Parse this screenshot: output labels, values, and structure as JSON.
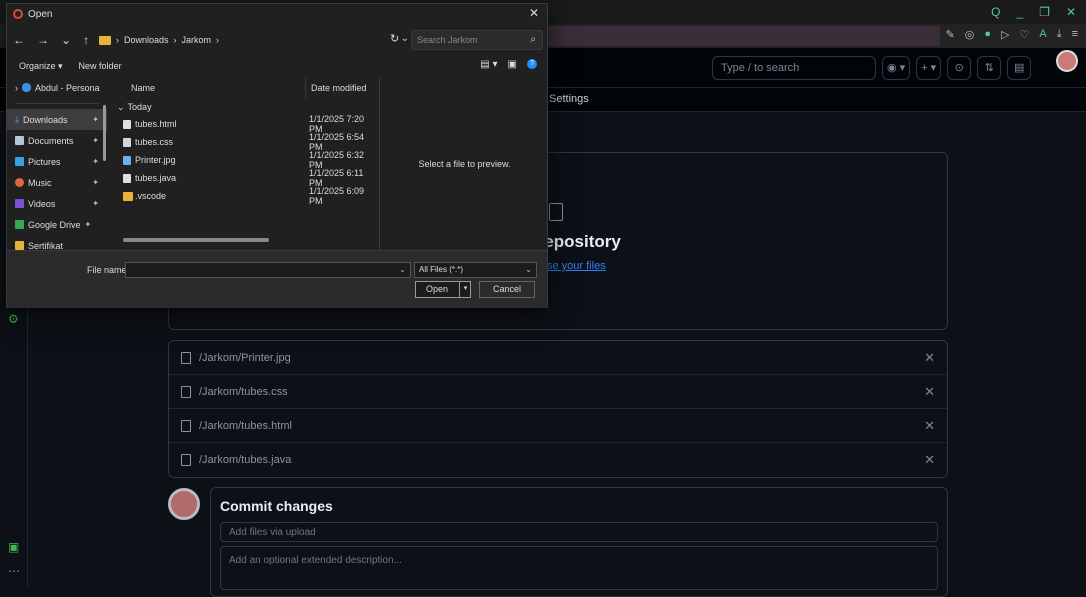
{
  "browser": {
    "top_icons": [
      "Q",
      "_",
      "❐",
      "✕"
    ],
    "toolbar_icons": [
      "✎",
      "◎",
      "●",
      "▷",
      "♡",
      "A",
      "⤓",
      "≡"
    ]
  },
  "github": {
    "search_placeholder": "Type / to search",
    "header_icons": [
      "◉ ▾",
      "+ ▾",
      "⊙",
      "⇅",
      "▤"
    ],
    "tab_settings": "Settings",
    "drop_title": "o add them to your repository",
    "drop_link": "se your files",
    "files": [
      {
        "name": "/Jarkom/Printer.jpg"
      },
      {
        "name": "/Jarkom/tubes.css"
      },
      {
        "name": "/Jarkom/tubes.html"
      },
      {
        "name": "/Jarkom/tubes.java"
      }
    ],
    "remove_icon": "✕",
    "commit": {
      "title": "Commit changes",
      "summary_placeholder": "Add files via upload",
      "description_placeholder": "Add an optional extended description..."
    }
  },
  "dialog": {
    "title": "Open",
    "close": "✕",
    "nav_arrows": [
      "←",
      "→",
      "⌄",
      "↑"
    ],
    "breadcrumb": [
      "Downloads",
      "Jarkom"
    ],
    "breadcrumb_sep": "›",
    "search_placeholder": "Search Jarkom",
    "organize": "Organize ▾",
    "new_folder": "New folder",
    "sidebar": [
      {
        "label": "Abdul - Persona",
        "icon": "cloud-icon",
        "color": "#3a8ee6",
        "pinned": false,
        "expander": "›"
      },
      {
        "label": "Downloads",
        "icon": "download-icon",
        "color": "#4aa3ff",
        "pinned": true,
        "selected": true
      },
      {
        "label": "Documents",
        "icon": "document-icon",
        "color": "#b7c4d4",
        "pinned": true
      },
      {
        "label": "Pictures",
        "icon": "picture-icon",
        "color": "#3aa0e6",
        "pinned": true
      },
      {
        "label": "Music",
        "icon": "music-icon",
        "color": "#e0663f",
        "pinned": true
      },
      {
        "label": "Videos",
        "icon": "video-icon",
        "color": "#7a52d4",
        "pinned": true
      },
      {
        "label": "Google Drive",
        "icon": "google-drive-icon",
        "color": "#34a853",
        "pinned": true
      },
      {
        "label": "Sertifikat",
        "icon": "folder-icon",
        "color": "#e8b33a",
        "pinned": false
      }
    ],
    "columns": {
      "name": "Name",
      "date": "Date modified"
    },
    "group": "Today",
    "files": [
      {
        "name": "tubes.html",
        "date": "1/1/2025 7:20 PM",
        "color": "#e0e0e0"
      },
      {
        "name": "tubes.css",
        "date": "1/1/2025 6:54 PM",
        "color": "#cfd8e6"
      },
      {
        "name": "Printer.jpg",
        "date": "1/1/2025 6:32 PM",
        "color": "#6fb0e8"
      },
      {
        "name": "tubes.java",
        "date": "1/1/2025 6:11 PM",
        "color": "#e0e0e0"
      },
      {
        "name": ".vscode",
        "date": "1/1/2025 6:09 PM",
        "color": "#e8b33a"
      }
    ],
    "preview_text": "Select a file to preview.",
    "file_name_label": "File name:",
    "file_name_value": "",
    "file_type": "All Files (*.*)",
    "open_button": "Open",
    "cancel_button": "Cancel"
  }
}
